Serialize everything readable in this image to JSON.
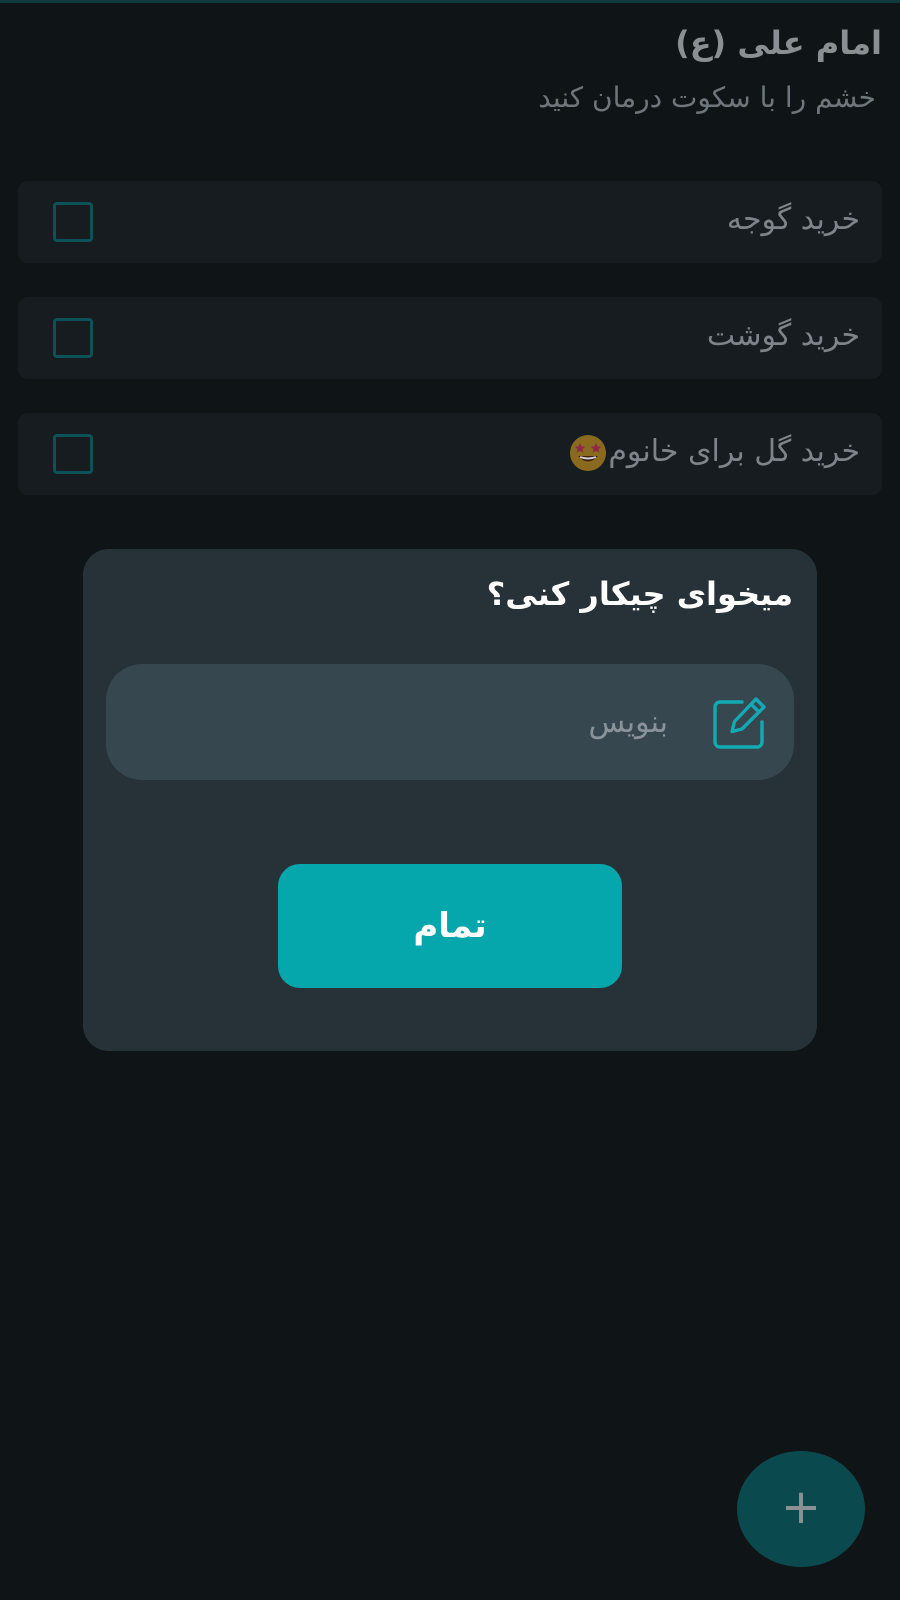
{
  "header": {
    "author": "امام علی (ع)",
    "quote": "خشم را با سکوت درمان کنید"
  },
  "tasks": [
    {
      "label": "خرید گوجه",
      "checked": false
    },
    {
      "label": "خرید گوشت",
      "checked": false
    },
    {
      "label": "خرید گل برای خانوم",
      "checked": false,
      "icon": "star-struck-emoji-icon"
    }
  ],
  "dialog": {
    "title": "میخوای چیکار کنی؟",
    "input_placeholder": "بنویس",
    "input_value": "",
    "input_icon": "edit-icon",
    "done_label": "تمام"
  },
  "fab": {
    "icon": "plus-icon",
    "glyph": "+"
  },
  "colors": {
    "background": "#0f1417",
    "task_card": "#171c20",
    "dialog": "#263238",
    "input": "#37474f",
    "accent": "#06a6ad"
  }
}
